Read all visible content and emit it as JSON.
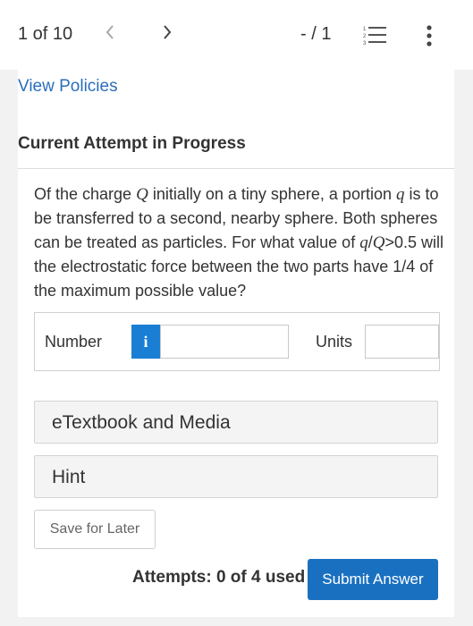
{
  "header": {
    "page_count": "1 of 10",
    "prev_icon": "‹",
    "next_icon": "›",
    "score": "- / 1",
    "list_icon": "list-icon",
    "more_icon": "more-vertical-icon"
  },
  "policies_link": "View Policies",
  "attempt_heading": "Current Attempt in Progress",
  "question": {
    "part1": "Of the charge ",
    "var_Q1": "Q",
    "part2": " initially on a tiny sphere, a portion ",
    "var_q1": "q",
    "part3": " is to be transferred to a second, nearby sphere. Both spheres can be treated as particles. For what value of ",
    "var_q2": "q",
    "slash": "/",
    "var_Q2": "Q",
    "part4": ">0.5 will the electrostatic force between the two parts have 1/4 of the maximum possible value?"
  },
  "answer": {
    "number_label": "Number",
    "info_icon": "i",
    "number_value": "",
    "units_label": "Units",
    "units_value": ""
  },
  "etextbook_label": "eTextbook and Media",
  "hint_label": "Hint",
  "save_label": "Save for Later",
  "attempts_text": "Attempts: 0 of 4 used",
  "submit_label": "Submit Answer",
  "colors": {
    "link": "#2a6ebb",
    "primary": "#1a70c0",
    "info": "#1a7ed4"
  }
}
